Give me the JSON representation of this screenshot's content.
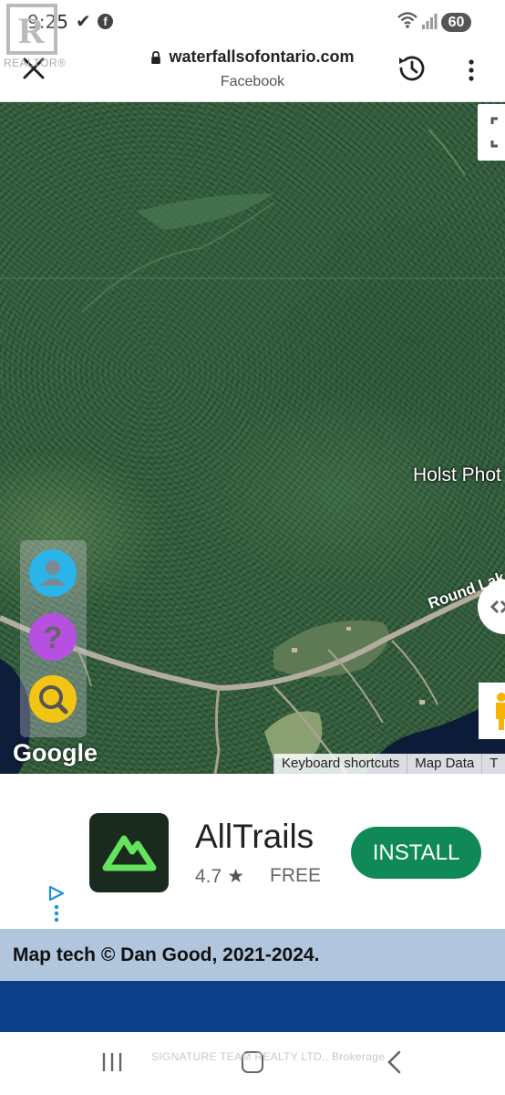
{
  "status_bar": {
    "time": "9:25",
    "battery": "60"
  },
  "watermark_logo": {
    "text": "REALTOR®"
  },
  "browser": {
    "domain": "waterfallsofontario.com",
    "subtitle": "Facebook"
  },
  "map": {
    "place_label": "Holst Phot",
    "road_label": "Round Lak",
    "logo": "Google",
    "footer_links": [
      "Keyboard shortcuts",
      "Map Data",
      "T"
    ],
    "side_buttons": [
      {
        "icon": "user-icon",
        "color": "#2ab4ea"
      },
      {
        "icon": "help-icon",
        "color": "#b650e0"
      },
      {
        "icon": "search-icon",
        "color": "#f2c514"
      }
    ]
  },
  "ad": {
    "app_name": "AllTrails",
    "rating": "4.7",
    "star": "★",
    "price": "FREE",
    "install_label": "INSTALL",
    "install_color": "#0f8a57"
  },
  "footer": {
    "credit": "Map tech © Dan Good, 2021-2024.",
    "credit_bg": "#b1c6dd",
    "bar_color": "#0d3f88"
  },
  "nav_watermark": "SIGNATURE TEAM REALTY LTD., Brokerage"
}
